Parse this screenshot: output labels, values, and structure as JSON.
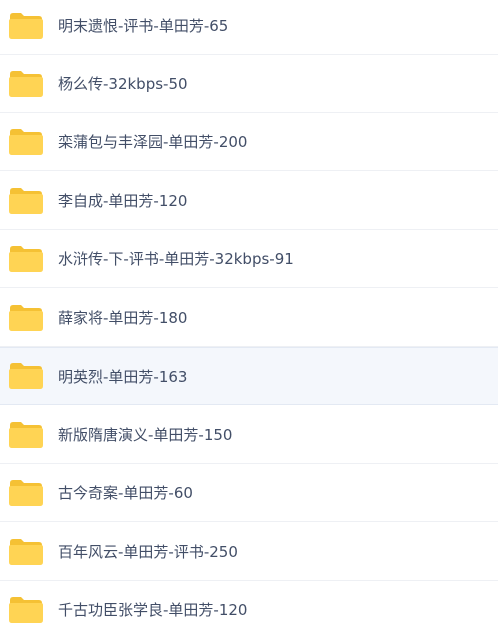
{
  "folders": [
    {
      "name": "明末遗恨-评书-单田芳-65",
      "icon": "folder-icon"
    },
    {
      "name": "杨么传-32kbps-50",
      "icon": "folder-icon"
    },
    {
      "name": "栾蒲包与丰泽园-单田芳-200",
      "icon": "folder-icon"
    },
    {
      "name": "李自成-单田芳-120",
      "icon": "folder-icon"
    },
    {
      "name": "水浒传-下-评书-单田芳-32kbps-91",
      "icon": "folder-icon"
    },
    {
      "name": "薛家将-单田芳-180",
      "icon": "folder-icon"
    },
    {
      "name": "明英烈-单田芳-163",
      "icon": "folder-icon"
    },
    {
      "name": "新版隋唐演义-单田芳-150",
      "icon": "folder-icon"
    },
    {
      "name": "古今奇案-单田芳-60",
      "icon": "folder-icon"
    },
    {
      "name": "百年风云-单田芳-评书-250",
      "icon": "folder-icon"
    },
    {
      "name": "千古功臣张学良-单田芳-120",
      "icon": "folder-icon"
    }
  ],
  "colors": {
    "folder_body": "#ffd454",
    "folder_back": "#f5c134",
    "text": "#424e67",
    "hover_bg": "#f4f7fc",
    "divider": "#eef0f4"
  },
  "hovered_index": 6
}
